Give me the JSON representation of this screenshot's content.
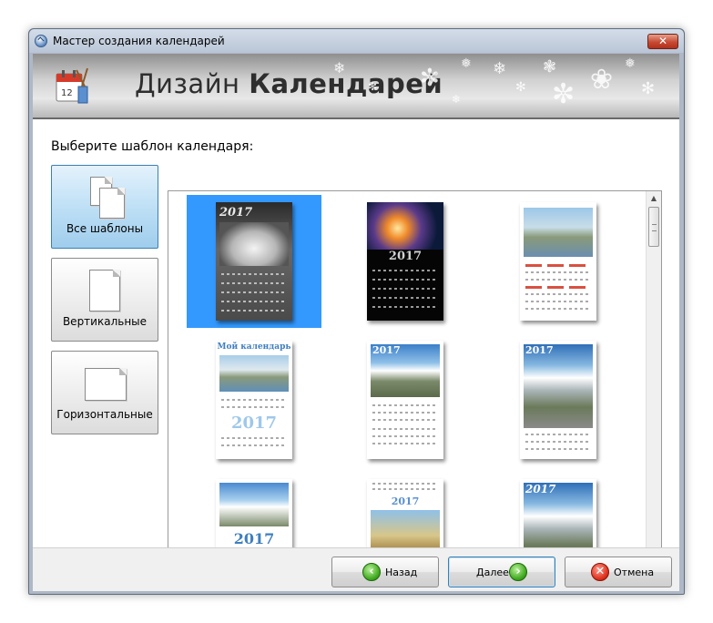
{
  "window": {
    "title": "Мастер создания календарей",
    "close_glyph": "✕"
  },
  "banner": {
    "title_light": "Дизайн",
    "title_bold": "Календарей",
    "icon": "calendar-brush-icon"
  },
  "content": {
    "prompt": "Выберите шаблон календаря:"
  },
  "categories": [
    {
      "label": "Все шаблоны",
      "icon": "all-templates-icon",
      "selected": true
    },
    {
      "label": "Вертикальные",
      "icon": "vertical-page-icon",
      "selected": false
    },
    {
      "label": "Горизонтальные",
      "icon": "horizontal-page-icon",
      "selected": false
    }
  ],
  "templates": [
    {
      "year_text": "2017",
      "style": "car-dark",
      "selected": true
    },
    {
      "year_text": "2017",
      "style": "space-dark",
      "selected": false
    },
    {
      "year_text": "",
      "style": "coast-red-grid",
      "selected": false
    },
    {
      "year_text": "Мой календарь",
      "style": "coast-blue-2017",
      "selected": false
    },
    {
      "year_text": "2017",
      "style": "mountain-sky",
      "selected": false
    },
    {
      "year_text": "2017",
      "style": "mountain-road",
      "selected": false
    },
    {
      "year_text": "2017",
      "style": "mountain-split",
      "selected": false
    },
    {
      "year_text": "2017",
      "style": "castle",
      "selected": false
    },
    {
      "year_text": "2017",
      "style": "mountain-road-2",
      "selected": false
    }
  ],
  "footer": {
    "back_label": "Назад",
    "next_label": "Далее",
    "cancel_label": "Отмена"
  },
  "colors": {
    "selection": "#3399ff",
    "accent_blue": "#3c7fb1",
    "green_icon": "#3fa91e",
    "red_icon": "#de2f1c"
  }
}
